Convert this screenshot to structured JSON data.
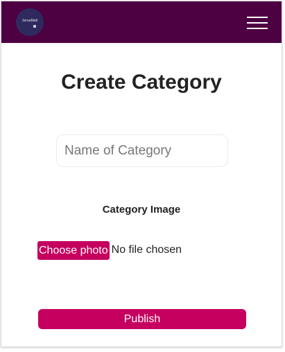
{
  "header": {
    "logo_text": "JersaMall",
    "menu_icon": "hamburger-menu-icon",
    "background_color": "#4d0042"
  },
  "form": {
    "title": "Create Category",
    "name_field": {
      "placeholder": "Name of Category",
      "value": ""
    },
    "image_label": "Category Image",
    "file_input": {
      "button_label": "Choose photo",
      "status_text": "No file chosen"
    },
    "publish_label": "Publish",
    "accent_color": "#c5005f"
  }
}
